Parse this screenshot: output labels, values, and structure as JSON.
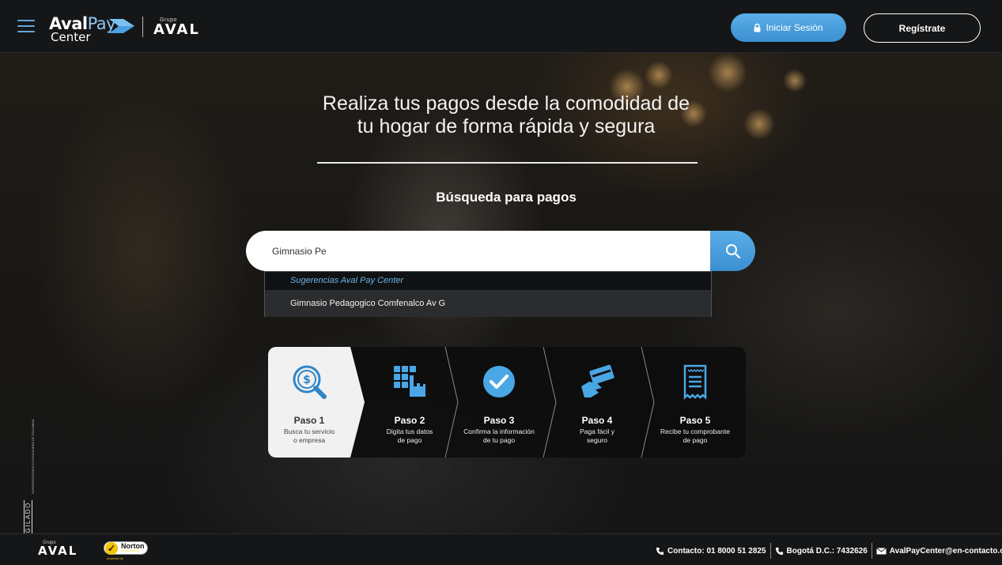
{
  "header": {
    "logo_line1_bold": "Aval",
    "logo_line1_thin": "Pay",
    "logo_line2": "Center",
    "grupo_small": "Grupo",
    "grupo_brand": "AVAL",
    "login_label": "Iniciar Sesión",
    "register_label": "Regístrate"
  },
  "hero": {
    "headline_line1": "Realiza tus pagos desde la comodidad de",
    "headline_line2": "tu hogar de forma rápida y segura",
    "search_title": "Búsqueda para pagos",
    "search_value": "Gimnasio Pe",
    "suggestions_header": "Sugerencias Aval Pay Center",
    "suggestions": [
      "Gimnasio Pedagogico Comfenalco Av G"
    ]
  },
  "steps": [
    {
      "title": "Paso 1",
      "desc_line1": "Busca tu servicio",
      "desc_line2": "o empresa",
      "icon": "search-dollar-icon",
      "active": true
    },
    {
      "title": "Paso 2",
      "desc_line1": "Digita tus datos",
      "desc_line2": "de pago",
      "icon": "keypad-hand-icon",
      "active": false
    },
    {
      "title": "Paso 3",
      "desc_line1": "Confirma la información",
      "desc_line2": "de tu pago",
      "icon": "check-circle-icon",
      "active": false
    },
    {
      "title": "Paso 4",
      "desc_line1": "Paga fácil y",
      "desc_line2": "seguro",
      "icon": "card-hand-icon",
      "active": false
    },
    {
      "title": "Paso 5",
      "desc_line1": "Recibe tu comprobante",
      "desc_line2": "de pago",
      "icon": "receipt-icon",
      "active": false
    }
  ],
  "vigilado": {
    "label": "VIGILADO",
    "entity": "SUPERINTENDENCIA FINANCIERA DE COLOMBIA"
  },
  "footer": {
    "grupo_small": "Grupo",
    "grupo_brand": "AVAL",
    "norton_brand": "Norton",
    "norton_secured": "SECURED",
    "norton_powered": "powered by",
    "contact_main": "Contacto: 01 8000 51 2825",
    "contact_bogota": "Bogotá D.C.: 7432626",
    "contact_email": "AvalPayCenter@en-contacto.co"
  },
  "colors": {
    "accent": "#4a9fe0",
    "accent_light": "#6cb4ea",
    "header_bg": "#151617"
  }
}
